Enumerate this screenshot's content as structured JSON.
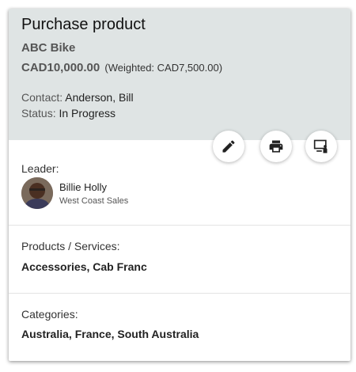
{
  "card": {
    "title": "Purchase product",
    "product": "ABC Bike",
    "amount": "CAD10,000.00",
    "weighted": "(Weighted: CAD7,500.00)",
    "contact_label": "Contact: ",
    "contact_value": "Anderson, Bill",
    "status_label": "Status: ",
    "status_value": "In Progress"
  },
  "actions": {
    "edit_icon": "pencil-icon",
    "print_icon": "printer-icon",
    "present_icon": "presentation-icon"
  },
  "leader": {
    "label": "Leader:",
    "name": "Billie Holly",
    "team": "West Coast Sales"
  },
  "products": {
    "label": "Products / Services:",
    "value": "Accessories, Cab Franc"
  },
  "categories": {
    "label": "Categories:",
    "value": "Australia, France, South Australia"
  },
  "colors": {
    "header_bg": "#dfe4e4",
    "card_bg": "#ffffff"
  }
}
